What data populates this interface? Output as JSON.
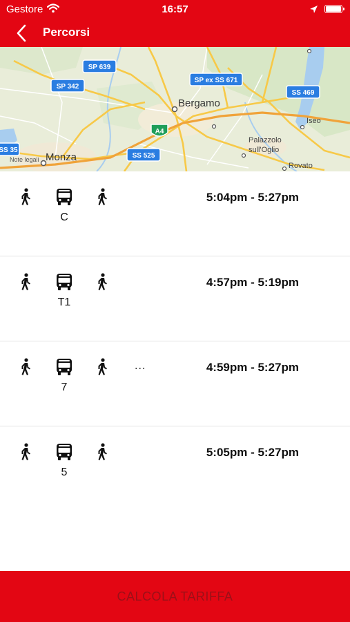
{
  "status_bar": {
    "carrier": "Gestore",
    "time": "16:57"
  },
  "nav": {
    "title": "Percorsi"
  },
  "map": {
    "labels": {
      "bergamo": "Bergamo",
      "monza": "Monza",
      "iseo": "Iseo",
      "palazzolo": "Palazzolo",
      "sull_oglio": "sull'Oglio",
      "rovato": "Rovato",
      "legal": "Note legali"
    },
    "shields": {
      "sp639": "SP 639",
      "sp342": "SP 342",
      "spex671": "SP ex SS 671",
      "ss469": "SS 469",
      "a4": "A4",
      "ss525": "SS 525",
      "ss35": "SS 35"
    }
  },
  "routes": [
    {
      "line": "C",
      "more": "",
      "time": "5:04pm - 5:27pm"
    },
    {
      "line": "T1",
      "more": "",
      "time": "4:57pm - 5:19pm"
    },
    {
      "line": "7",
      "more": "...",
      "time": "4:59pm - 5:27pm"
    },
    {
      "line": "5",
      "more": "",
      "time": "5:05pm - 5:27pm"
    }
  ],
  "footer": {
    "button_label": "CALCOLA TARIFFA"
  },
  "colors": {
    "brand_red": "#e30613",
    "map_shield_blue": "#2a7de1",
    "highway_green": "#1e9e5a"
  },
  "icons": [
    "wifi-icon",
    "location-arrow-icon",
    "battery-icon",
    "back-chevron-icon",
    "walk-icon",
    "bus-icon"
  ]
}
